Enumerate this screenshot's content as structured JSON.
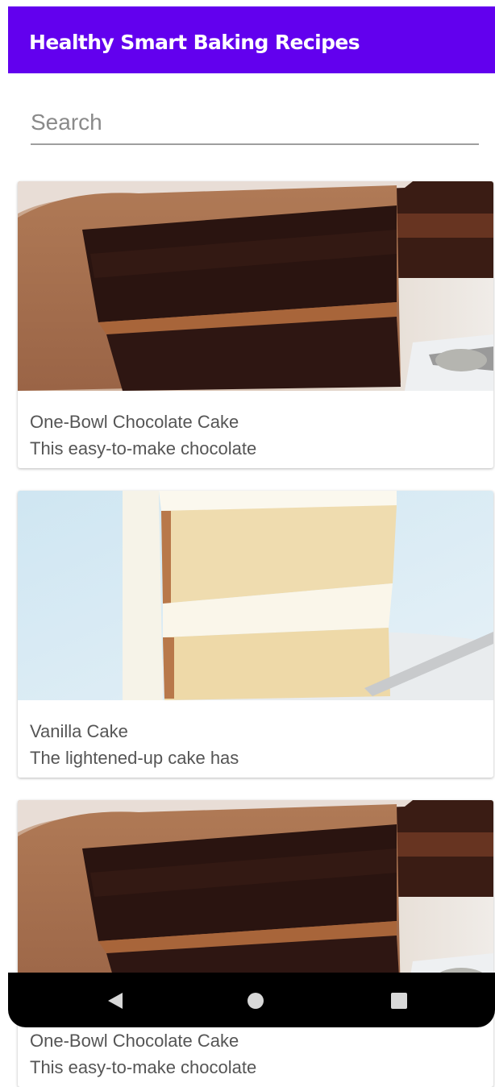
{
  "app_bar": {
    "title": "Healthy Smart Baking Recipes"
  },
  "search": {
    "placeholder": "Search",
    "value": ""
  },
  "recipes": [
    {
      "title": "One-Bowl Chocolate Cake",
      "snippet": "This easy-to-make chocolate",
      "image": "chocolate-cake"
    },
    {
      "title": "Vanilla Cake",
      "snippet": "The lightened-up cake has",
      "image": "vanilla-cake"
    },
    {
      "title": "One-Bowl Chocolate Cake",
      "snippet": "This easy-to-make chocolate",
      "image": "chocolate-cake"
    }
  ],
  "nav": {
    "back": "back-icon",
    "home": "home-icon",
    "recents": "recents-icon"
  },
  "colors": {
    "primary": "#6200EE",
    "nav_bar": "#000000",
    "text_secondary": "#555555"
  }
}
